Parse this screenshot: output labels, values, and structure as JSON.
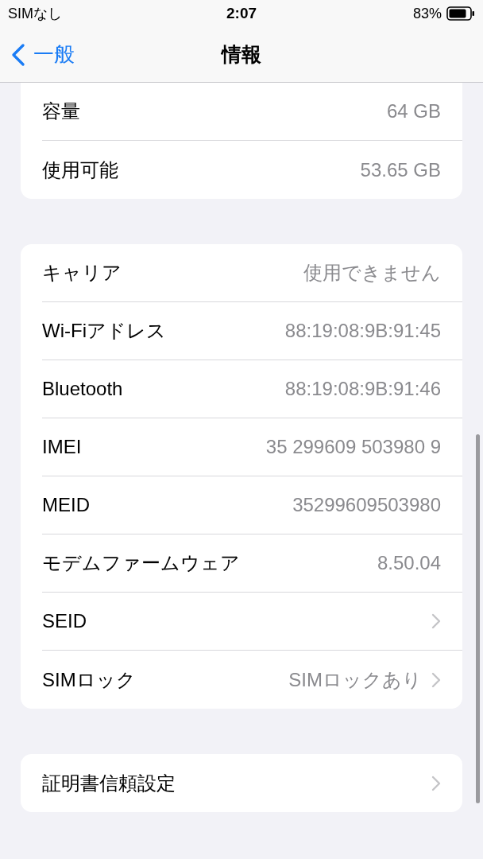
{
  "status_bar": {
    "carrier": "SIMなし",
    "time": "2:07",
    "battery": "83%"
  },
  "nav": {
    "back": "一般",
    "title": "情報"
  },
  "groups": [
    {
      "rows": [
        {
          "label": "容量",
          "value": "64 GB",
          "chevron": false
        },
        {
          "label": "使用可能",
          "value": "53.65 GB",
          "chevron": false
        }
      ]
    },
    {
      "rows": [
        {
          "label": "キャリア",
          "value": "使用できません",
          "chevron": false
        },
        {
          "label": "Wi-Fiアドレス",
          "value": "88:19:08:9B:91:45",
          "chevron": false
        },
        {
          "label": "Bluetooth",
          "value": "88:19:08:9B:91:46",
          "chevron": false
        },
        {
          "label": "IMEI",
          "value": "35 299609 503980 9",
          "chevron": false
        },
        {
          "label": "MEID",
          "value": "35299609503980",
          "chevron": false
        },
        {
          "label": "モデムファームウェア",
          "value": "8.50.04",
          "chevron": false
        },
        {
          "label": "SEID",
          "chevron": true
        },
        {
          "label": "SIMロック",
          "value": "SIMロックあり",
          "chevron": true
        }
      ]
    },
    {
      "rows": [
        {
          "label": "証明書信頼設定",
          "chevron": true
        }
      ]
    }
  ]
}
